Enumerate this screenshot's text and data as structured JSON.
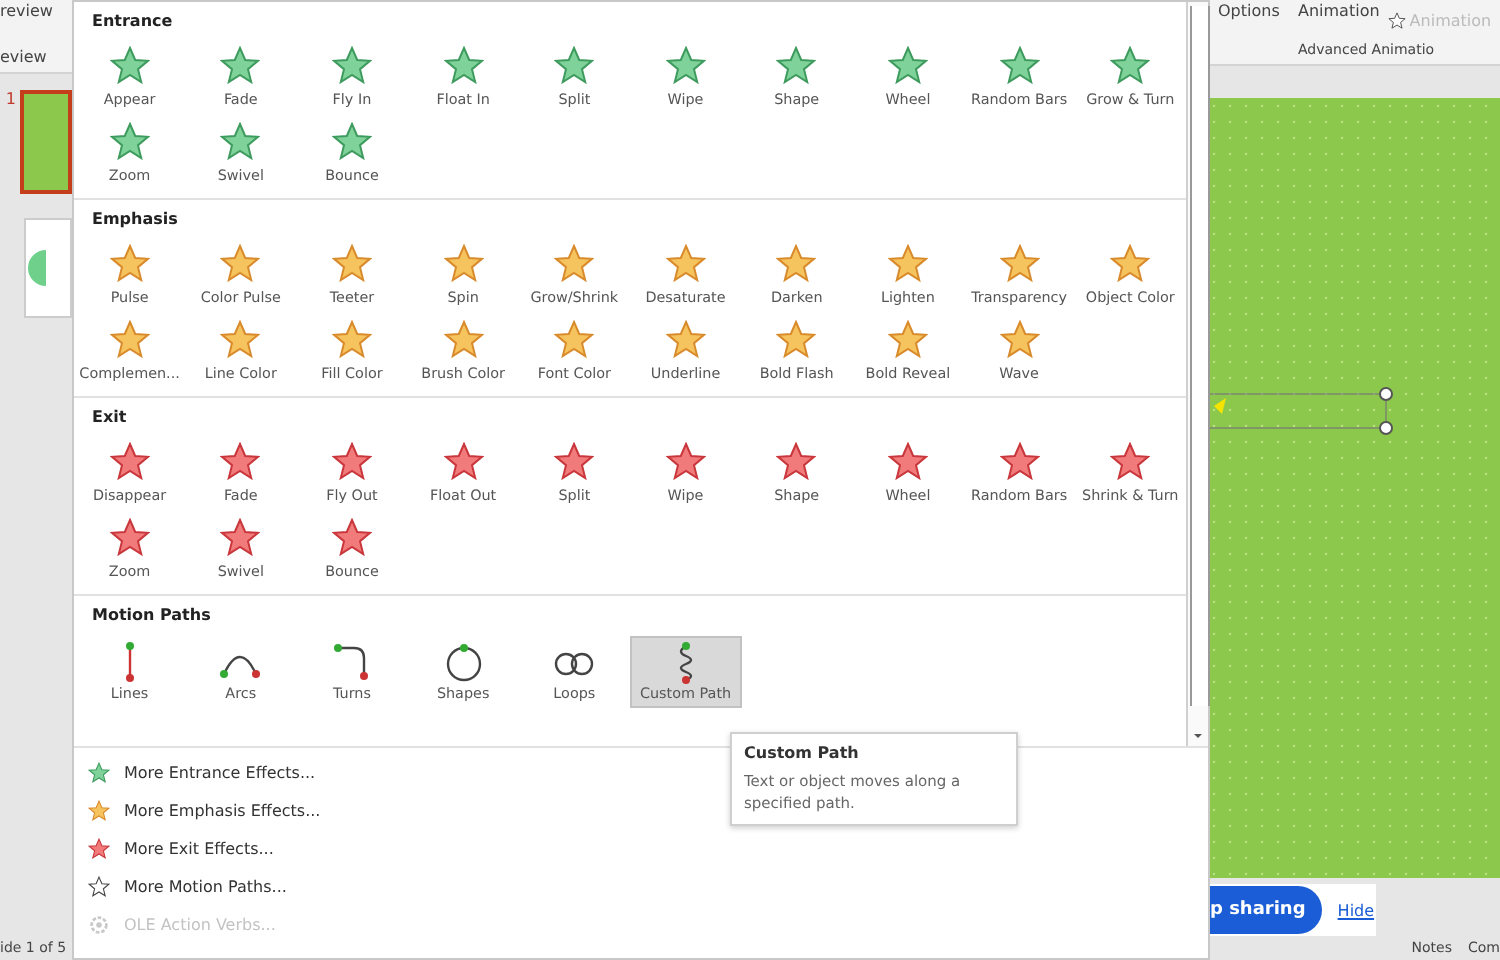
{
  "ribbon_left": {
    "button": "review",
    "group": "eview"
  },
  "ribbon_right": {
    "effect_options": "Options",
    "add_animation": "Animation",
    "animation_pane": "Animation",
    "group": "Advanced Animatio"
  },
  "slides": [
    {
      "number": "1",
      "selected": true,
      "kind": "green"
    },
    {
      "kind": "white",
      "selected": false
    }
  ],
  "status_bar": {
    "slide": "ide 1 of 5",
    "notes": "Notes",
    "comments": "Com"
  },
  "sharing_bar": {
    "button": "p sharing",
    "link": "Hide"
  },
  "gallery": {
    "sections": [
      {
        "title": "Entrance",
        "kind": "entrance",
        "items": [
          {
            "label": "Appear",
            "selected": false
          },
          {
            "label": "Fade",
            "selected": false
          },
          {
            "label": "Fly In",
            "selected": false
          },
          {
            "label": "Float In",
            "selected": false
          },
          {
            "label": "Split",
            "selected": false
          },
          {
            "label": "Wipe",
            "selected": false
          },
          {
            "label": "Shape",
            "selected": false
          },
          {
            "label": "Wheel",
            "selected": false
          },
          {
            "label": "Random Bars",
            "selected": false
          },
          {
            "label": "Grow & Turn",
            "selected": false
          },
          {
            "label": "Zoom",
            "selected": false
          },
          {
            "label": "Swivel",
            "selected": false
          },
          {
            "label": "Bounce",
            "selected": false
          }
        ]
      },
      {
        "title": "Emphasis",
        "kind": "emphasis",
        "items": [
          {
            "label": "Pulse",
            "selected": false
          },
          {
            "label": "Color Pulse",
            "selected": false
          },
          {
            "label": "Teeter",
            "selected": false
          },
          {
            "label": "Spin",
            "selected": false
          },
          {
            "label": "Grow/Shrink",
            "selected": false
          },
          {
            "label": "Desaturate",
            "selected": false
          },
          {
            "label": "Darken",
            "selected": false
          },
          {
            "label": "Lighten",
            "selected": false
          },
          {
            "label": "Transparency",
            "selected": false
          },
          {
            "label": "Object Color",
            "selected": false
          },
          {
            "label": "Complemen...",
            "selected": false
          },
          {
            "label": "Line Color",
            "selected": false
          },
          {
            "label": "Fill Color",
            "selected": false
          },
          {
            "label": "Brush Color",
            "selected": false
          },
          {
            "label": "Font Color",
            "selected": false
          },
          {
            "label": "Underline",
            "selected": false
          },
          {
            "label": "Bold Flash",
            "selected": false
          },
          {
            "label": "Bold Reveal",
            "selected": false
          },
          {
            "label": "Wave",
            "selected": false
          }
        ]
      },
      {
        "title": "Exit",
        "kind": "exit",
        "items": [
          {
            "label": "Disappear",
            "selected": false
          },
          {
            "label": "Fade",
            "selected": false
          },
          {
            "label": "Fly Out",
            "selected": false
          },
          {
            "label": "Float Out",
            "selected": false
          },
          {
            "label": "Split",
            "selected": false
          },
          {
            "label": "Wipe",
            "selected": false
          },
          {
            "label": "Shape",
            "selected": false
          },
          {
            "label": "Wheel",
            "selected": false
          },
          {
            "label": "Random Bars",
            "selected": false
          },
          {
            "label": "Shrink & Turn",
            "selected": false
          },
          {
            "label": "Zoom",
            "selected": false
          },
          {
            "label": "Swivel",
            "selected": false
          },
          {
            "label": "Bounce",
            "selected": false
          }
        ]
      },
      {
        "title": "Motion Paths",
        "kind": "motion",
        "items": [
          {
            "label": "Lines",
            "kind": "line",
            "selected": false
          },
          {
            "label": "Arcs",
            "kind": "arc",
            "selected": false
          },
          {
            "label": "Turns",
            "kind": "turn",
            "selected": false
          },
          {
            "label": "Shapes",
            "kind": "shape",
            "selected": false
          },
          {
            "label": "Loops",
            "kind": "loop",
            "selected": false
          },
          {
            "label": "Custom Path",
            "kind": "custom",
            "selected": true
          }
        ]
      }
    ]
  },
  "more_items": [
    {
      "label": "More Entrance Effects...",
      "kind": "entrance",
      "disabled": false
    },
    {
      "label": "More Emphasis Effects...",
      "kind": "emphasis",
      "disabled": false
    },
    {
      "label": "More Exit Effects...",
      "kind": "exit",
      "disabled": false
    },
    {
      "label": "More Motion Paths...",
      "kind": "motion",
      "disabled": false
    },
    {
      "label": "OLE Action Verbs...",
      "kind": "ole",
      "disabled": true
    }
  ],
  "tooltip": {
    "title": "Custom Path",
    "text": "Text or object moves along a specified path."
  }
}
